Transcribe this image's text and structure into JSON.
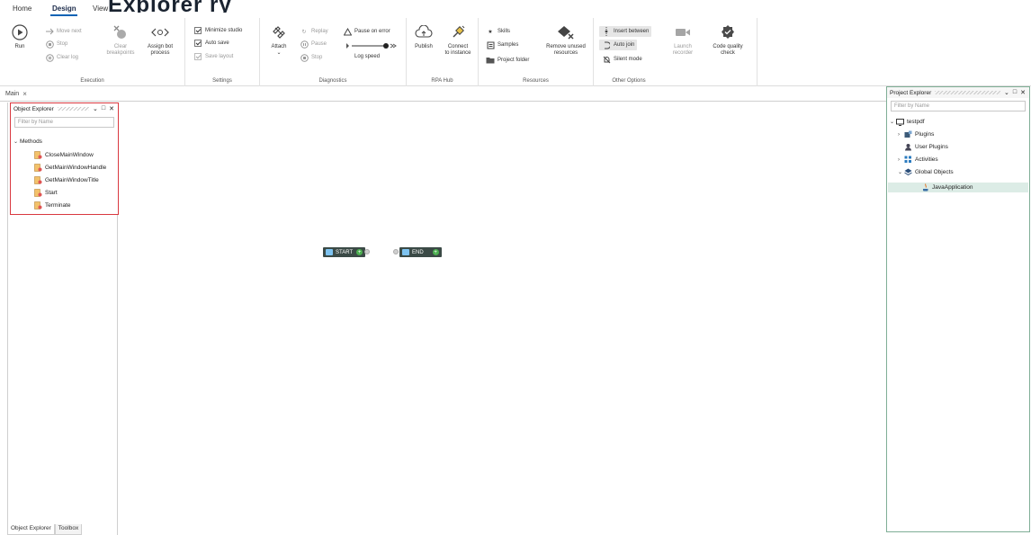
{
  "menu": {
    "home": "Home",
    "design": "Design",
    "view": "View",
    "banner_fragment": "Explorer  ry"
  },
  "ribbon": {
    "execution": {
      "label": "Execution",
      "run": "Run",
      "move_next": "Move next",
      "stop": "Stop",
      "clear_log": "Clear log",
      "clear_breakpoints_1": "Clear",
      "clear_breakpoints_2": "breakpoints",
      "assign_bot_1": "Assign bot",
      "assign_bot_2": "process"
    },
    "settings": {
      "label": "Settings",
      "minimize_studio": "Minimize studio",
      "auto_save": "Auto save",
      "save_layout": "Save layout"
    },
    "diagnostics": {
      "label": "Diagnostics",
      "attach": "Attach",
      "replay": "Replay",
      "pause": "Pause",
      "stop": "Stop",
      "pause_on_error": "Pause on error",
      "log_speed": "Log speed"
    },
    "rpa_hub": {
      "label": "RPA Hub",
      "publish": "Publish",
      "connect_1": "Connect",
      "connect_2": "to instance"
    },
    "resources": {
      "label": "Resources",
      "skills": "Skills",
      "samples": "Samples",
      "project_folder": "Project folder",
      "remove_unused_1": "Remove unused",
      "remove_unused_2": "resources"
    },
    "other_options": {
      "label": "Other Options",
      "insert_between": "Insert between",
      "auto_join": "Auto join",
      "silent_mode": "Silent mode",
      "launch_recorder_1": "Launch",
      "launch_recorder_2": "recorder",
      "code_quality_1": "Code quality",
      "code_quality_2": "check"
    }
  },
  "document_tab": {
    "label": "Main",
    "close": "×"
  },
  "object_explorer": {
    "title": "Object Explorer",
    "filter_placeholder": "Filter by Name",
    "root": "Methods",
    "methods": [
      "CloseMainWindow",
      "GetMainWindowHandle",
      "GetMainWindowTitle",
      "Start",
      "Terminate"
    ]
  },
  "bottom_tabs": {
    "object_explorer": "Object Explorer",
    "toolbox": "Toolbox"
  },
  "project_explorer": {
    "title": "Project Explorer",
    "filter_placeholder": "Filter by Name",
    "root": "testpdf",
    "plugins": "Plugins",
    "user_plugins": "User Plugins",
    "activities": "Activities",
    "global_objects": "Global Objects",
    "java_application": "JavaApplication"
  },
  "canvas": {
    "start_node": "START",
    "end_node": "END"
  },
  "colors": {
    "accent": "#0b63b5",
    "highlight_border": "#d9383f",
    "node_bg": "#3b4a46",
    "node_plus": "#4caf50",
    "selection": "#dcece6"
  }
}
